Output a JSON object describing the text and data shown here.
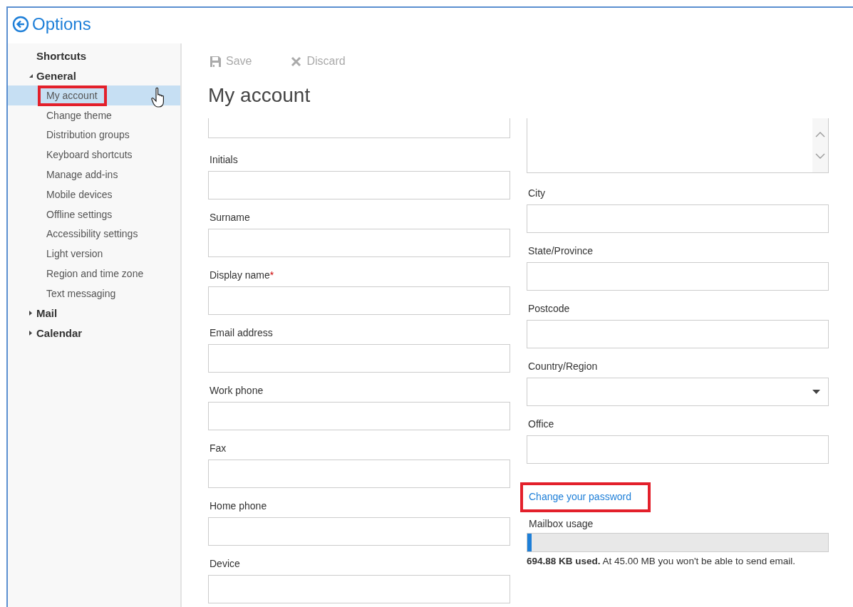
{
  "header": {
    "title": "Options"
  },
  "sidebar": {
    "items": [
      {
        "kind": "link",
        "label": "Shortcuts"
      },
      {
        "kind": "group",
        "label": "General",
        "expanded": true,
        "children": [
          {
            "label": "My account",
            "selected": true,
            "annotated": true,
            "hovered": true
          },
          {
            "label": "Change theme",
            "selected": false
          },
          {
            "label": "Distribution groups",
            "selected": false
          },
          {
            "label": "Keyboard shortcuts",
            "selected": false
          },
          {
            "label": "Manage add-ins",
            "selected": false
          },
          {
            "label": "Mobile devices",
            "selected": false
          },
          {
            "label": "Offline settings",
            "selected": false
          },
          {
            "label": "Accessibility settings",
            "selected": false
          },
          {
            "label": "Light version",
            "selected": false
          },
          {
            "label": "Region and time zone",
            "selected": false
          },
          {
            "label": "Text messaging",
            "selected": false
          }
        ]
      },
      {
        "kind": "group",
        "label": "Mail",
        "expanded": false
      },
      {
        "kind": "group",
        "label": "Calendar",
        "expanded": false
      }
    ]
  },
  "toolbar": [
    {
      "kind": "save",
      "label": "Save",
      "disabled": true
    },
    {
      "kind": "discard",
      "label": "Discard",
      "disabled": true
    }
  ],
  "page": {
    "title": "My account",
    "left_fields": [
      {
        "kind": "text_cut"
      },
      {
        "kind": "text",
        "label": "Initials"
      },
      {
        "kind": "text",
        "label": "Surname"
      },
      {
        "kind": "text",
        "label": "Display name",
        "required_mark": "*"
      },
      {
        "kind": "text",
        "label": "Email address"
      },
      {
        "kind": "text",
        "label": "Work phone"
      },
      {
        "kind": "text",
        "label": "Fax"
      },
      {
        "kind": "text",
        "label": "Home phone"
      },
      {
        "kind": "text",
        "label": "Device"
      }
    ],
    "right_fields": [
      {
        "kind": "textarea_cut"
      },
      {
        "kind": "text",
        "label": "City"
      },
      {
        "kind": "text",
        "label": "State/Province"
      },
      {
        "kind": "text",
        "label": "Postcode"
      },
      {
        "kind": "select",
        "label": "Country/Region"
      },
      {
        "kind": "text",
        "label": "Office"
      }
    ],
    "password_link": {
      "label": "Change your password",
      "annotated": true
    },
    "mailbox": {
      "label": "Mailbox usage",
      "level": 0.015,
      "note": "**694.88 KB used.**  At 45.00 MB you won't be able to send email."
    }
  }
}
